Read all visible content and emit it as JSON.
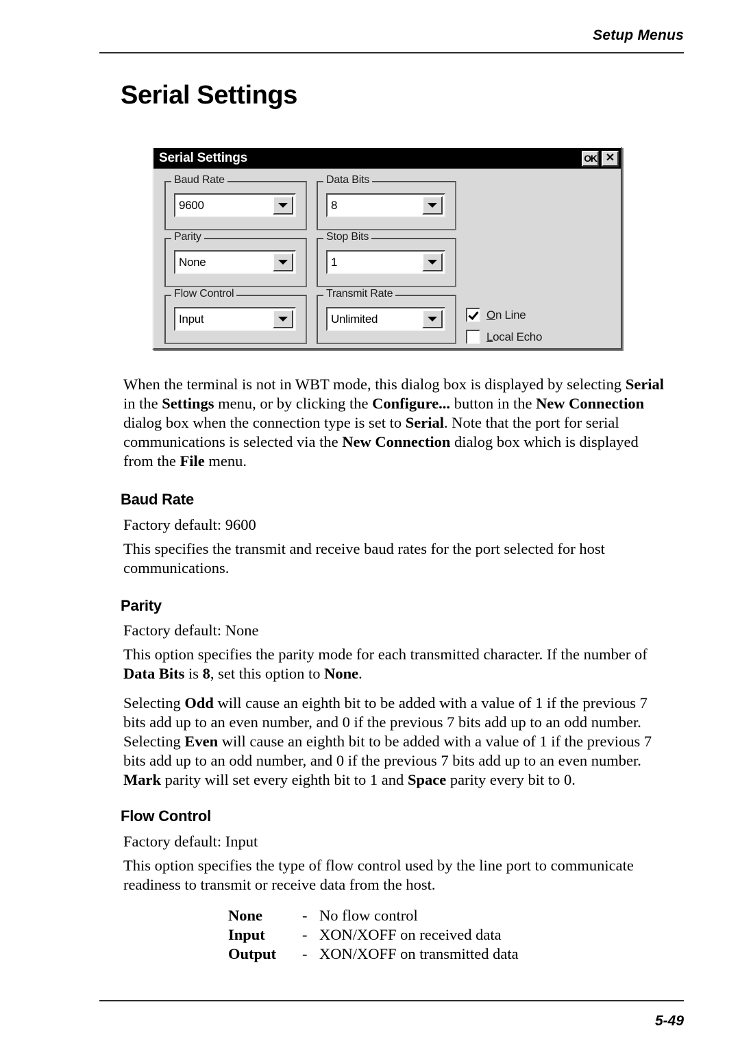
{
  "page": {
    "running_head": "Setup Menus",
    "title": "Serial Settings",
    "folio": "5-49"
  },
  "dialog": {
    "title": "Serial Settings",
    "buttons": {
      "ok_label": "OK",
      "close_label": "✕"
    },
    "groups": [
      {
        "label": "Baud Rate",
        "value": "9600"
      },
      {
        "label": "Data Bits",
        "value": "8"
      },
      {
        "label": "Parity",
        "value": "None"
      },
      {
        "label": "Stop Bits",
        "value": "1"
      },
      {
        "label": "Flow Control",
        "value": "Input"
      },
      {
        "label": "Transmit Rate",
        "value": "Unlimited"
      }
    ],
    "checkboxes": [
      {
        "label_accel": "O",
        "label_rest": "n Line",
        "checked": true
      },
      {
        "label_accel": "L",
        "label_rest": "ocal Echo",
        "checked": false
      }
    ]
  },
  "body": {
    "intro": {
      "p1": "When the terminal is not in WBT mode, this dialog box is displayed by selecting ",
      "b1": "Serial",
      "p2": " in the ",
      "b2": "Settings",
      "p3": " menu, or by clicking the ",
      "b3": "Configure...",
      "p4": " button in the ",
      "b4": "New Connection",
      "p5": " dialog box when the connection type is set to ",
      "b5": "Serial",
      "p6": ". Note that the port for serial communications is selected via the ",
      "b6": "New Connection",
      "p7": " dialog box which is displayed from the ",
      "b7": "File",
      "p8": " menu."
    },
    "baud_rate": {
      "heading": "Baud Rate",
      "default": "Factory default: 9600",
      "description": "This specifies the transmit and receive baud rates for the port selected for host communications."
    },
    "parity": {
      "heading": "Parity",
      "default": "Factory default: None",
      "desc_a1": "This option specifies the parity mode for each transmitted character. If the number of ",
      "desc_b1": "Data Bits",
      "desc_a2": " is ",
      "desc_b2": "8",
      "desc_a3": ", set this option to ",
      "desc_b3": "None",
      "desc_a4": ".",
      "detail_a1": "Selecting ",
      "detail_b1": "Odd",
      "detail_a2": " will cause an eighth bit to be added with a value of 1 if the previous 7 bits add up to an even number, and 0 if the previous 7 bits add up to an odd number. Selecting ",
      "detail_b2": "Even",
      "detail_a3": " will cause an eighth bit to be added with a value of 1 if the previous 7 bits add up to an odd number, and 0 if the previous 7 bits add up to an even number. ",
      "detail_b3": "Mark",
      "detail_a4": " parity will set every eighth bit to 1 and ",
      "detail_b4": "Space",
      "detail_a5": " parity every bit to 0."
    },
    "flow_control": {
      "heading": "Flow Control",
      "default": "Factory default: Input",
      "description": "This option specifies the type of flow control used by the line port to communicate readiness to transmit or receive data from the host.",
      "options": [
        {
          "term": "None",
          "dash": "-",
          "desc": "No flow control"
        },
        {
          "term": "Input",
          "dash": "-",
          "desc": "XON/XOFF on received data"
        },
        {
          "term": "Output",
          "dash": "-",
          "desc": "XON/XOFF on transmitted data"
        }
      ]
    }
  }
}
